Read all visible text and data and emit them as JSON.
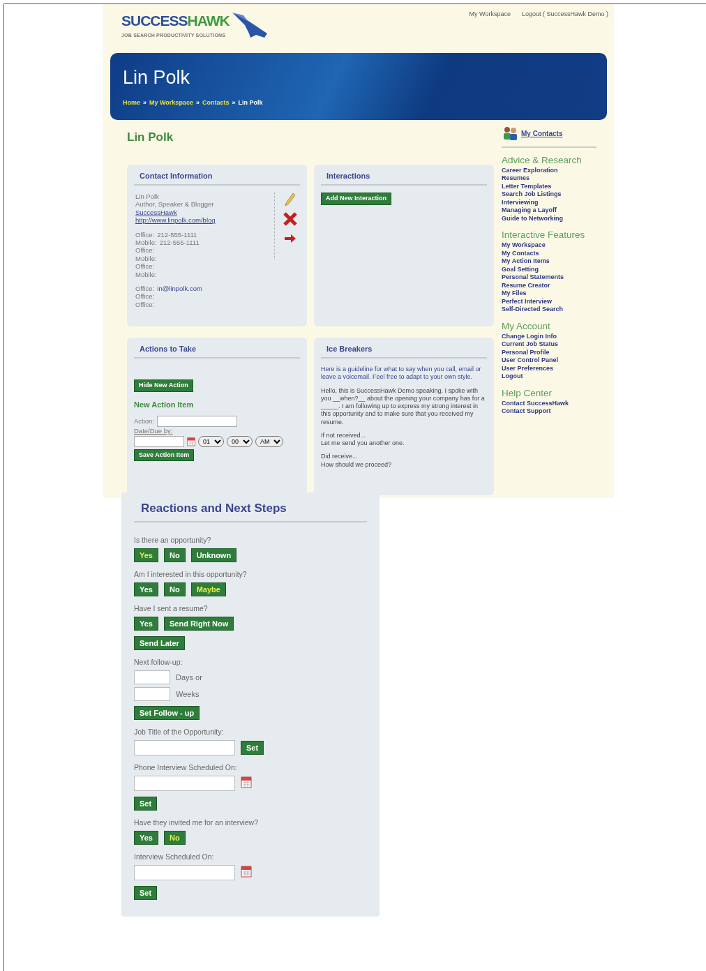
{
  "header": {
    "logo": {
      "first": "SUCCESS",
      "second": "HAWK",
      "tagline": "JOB SEARCH PRODUCTIVITY SOLUTIONS"
    },
    "top_links": [
      "My Workspace",
      "Logout ( SuccessHawk Demo )"
    ]
  },
  "banner": {
    "title": "Lin Polk",
    "breadcrumb": [
      {
        "label": "Home",
        "current": false
      },
      {
        "label": "My Workspace",
        "current": false
      },
      {
        "label": "Contacts",
        "current": false
      },
      {
        "label": "Lin Polk",
        "current": true
      }
    ],
    "separator": "»"
  },
  "page_heading": "Lin Polk",
  "contact_info": {
    "title": "Contact Information",
    "groups": [
      [
        {
          "value": "Lin Polk",
          "link": false
        },
        {
          "value": "Author, Speaker & Blogger",
          "link": false
        },
        {
          "value": "SuccessHawk",
          "link": true
        },
        {
          "value": "http://www.linpolk.com/blog",
          "link": true
        }
      ],
      [
        {
          "label": "Office:",
          "value": "212-555-1111",
          "link": false
        },
        {
          "label": "Mobile:",
          "value": "212-555-1111",
          "link": false
        },
        {
          "label": "Office:"
        },
        {
          "label": "Mobile:"
        },
        {
          "label": "Office:"
        },
        {
          "label": "Mobile:"
        }
      ],
      [
        {
          "label": "Office:",
          "value": "in@linpolk.com",
          "link": true
        },
        {
          "label": "Office:"
        },
        {
          "label": "Office:"
        }
      ]
    ]
  },
  "interactions": {
    "title": "Interactions",
    "button": "Add New Interaction"
  },
  "actions": {
    "title": "Actions to Take",
    "hide_button": "Hide New Action",
    "subheading": "New Action Item",
    "action_label": "Action:",
    "due_label": "Date/Due by:",
    "hour": "01",
    "minute": "00",
    "meridiem": "AM",
    "save_button": "Save Action Item"
  },
  "ice_breakers": {
    "title": "Ice Breakers",
    "intro": "Here is a guideline for what to say when you call, email or leave a voicemail. Feel free to adapt to your own style.",
    "paragraphs": [
      [
        "Hello, this is SuccessHawk Demo speaking. I spoke with you __when?__ about the opening your company has for a _____. I am following up to express my strong interest in this opportunity and to make sure that you received my resume."
      ],
      [
        "If not received...",
        "Let me send you another one."
      ],
      [
        "Did receive...",
        "How should we proceed?"
      ]
    ]
  },
  "sidebar": {
    "my_contacts": "My Contacts",
    "sections": [
      {
        "title": "Advice & Research",
        "links": [
          "Career Exploration",
          "Resumes",
          "Letter Templates",
          "Search Job Listings",
          "Interviewing",
          "Managing a Layoff",
          "Guide to Networking"
        ]
      },
      {
        "title": "Interactive Features",
        "links": [
          "My Workspace",
          "My Contacts",
          "My Action Items",
          "Goal Setting",
          "Personal Statements",
          "Resume Creator",
          "My Files",
          "Perfect Interview",
          "Self-Directed Search"
        ]
      },
      {
        "title": "My Account",
        "links": [
          "Change Login Info",
          "Current Job Status",
          "Personal Profile",
          "User Control Panel",
          "User Preferences",
          "Logout"
        ]
      },
      {
        "title": "Help Center",
        "links": [
          "Contact SuccessHawk",
          "Contact Support"
        ]
      }
    ]
  },
  "reactions": {
    "title": "Reactions and Next Steps",
    "items": [
      {
        "kind": "choice",
        "label": "Is there an opportunity?",
        "options": [
          {
            "label": "Yes",
            "selected": true
          },
          {
            "label": "No",
            "selected": false
          },
          {
            "label": "Unknown",
            "selected": false
          }
        ]
      },
      {
        "kind": "choice",
        "label": "Am I interested in this opportunity?",
        "options": [
          {
            "label": "Yes",
            "selected": false
          },
          {
            "label": "No",
            "selected": false
          },
          {
            "label": "Maybe",
            "selected": true
          }
        ]
      },
      {
        "kind": "choice",
        "label": "Have I sent a resume?",
        "options": [
          {
            "label": "Yes",
            "selected": false
          },
          {
            "label": "Send Right Now",
            "selected": false
          },
          {
            "label": "Send Later",
            "selected": false
          }
        ]
      },
      {
        "kind": "follow_up",
        "label": "Next follow-up:",
        "units": [
          "Days or",
          "Weeks"
        ],
        "button": "Set Follow - up"
      },
      {
        "kind": "text_set",
        "label": "Job Title of the Opportunity:",
        "button": "Set"
      },
      {
        "kind": "date_set",
        "label": "Phone Interview Scheduled On:",
        "button": "Set"
      },
      {
        "kind": "choice",
        "label": "Have they invited me for an interview?",
        "options": [
          {
            "label": "Yes",
            "selected": false
          },
          {
            "label": "No",
            "selected": true
          }
        ]
      },
      {
        "kind": "date_set",
        "label": "Interview Scheduled On:",
        "button": "Set"
      }
    ]
  }
}
